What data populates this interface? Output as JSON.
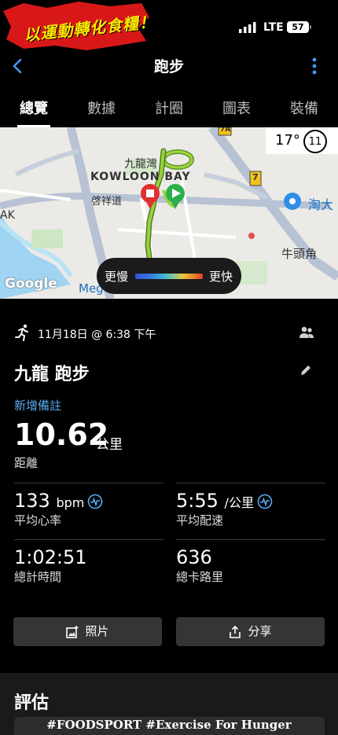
{
  "status_bar": {
    "logo_text": "以運動轉化食糧！",
    "network": "LTE",
    "battery": "57"
  },
  "nav": {
    "title": "跑步"
  },
  "tabs": [
    {
      "label": "總覽"
    },
    {
      "label": "數據"
    },
    {
      "label": "計圈"
    },
    {
      "label": "圖表"
    },
    {
      "label": "裝備"
    }
  ],
  "map": {
    "labels": {
      "kowloon_bay_zh": "九龍灣",
      "kowloon_bay_en": "KOWLOON BAY",
      "kai_cheung_road": "啓祥道",
      "ngau_tau_kok": "牛頭角",
      "tao_da": "淘大",
      "ak": "AK",
      "meg": "Meg",
      "route_7": "7",
      "route_7a": "7A"
    },
    "weather": {
      "temperature": "17°",
      "wind": "11"
    },
    "pace_legend": {
      "slow": "更慢",
      "fast": "更快"
    },
    "attribution": "Google"
  },
  "activity": {
    "date": "11月18日 @ 6:38 下午",
    "name": "九龍 跑步",
    "add_note": "新增備註",
    "distance": {
      "value": "10.62",
      "unit": "公里",
      "label": "距離"
    },
    "stats": {
      "heart_rate": {
        "value": "133",
        "unit": "bpm",
        "label": "平均心率"
      },
      "pace": {
        "value": "5:55",
        "unit": "/公里",
        "label": "平均配速"
      },
      "time": {
        "value": "1:02:51",
        "label": "總計時間"
      },
      "calories": {
        "value": "636",
        "label": "總卡路里"
      }
    },
    "buttons": {
      "photos": "照片",
      "share": "分享"
    }
  },
  "evaluation": {
    "title": "評估"
  },
  "banner": "#FOODSPORT #Exercise For Hunger",
  "colors": {
    "accent": "#5aaaf0",
    "background": "#000000",
    "button": "#353535",
    "route": "#8ac43f"
  }
}
